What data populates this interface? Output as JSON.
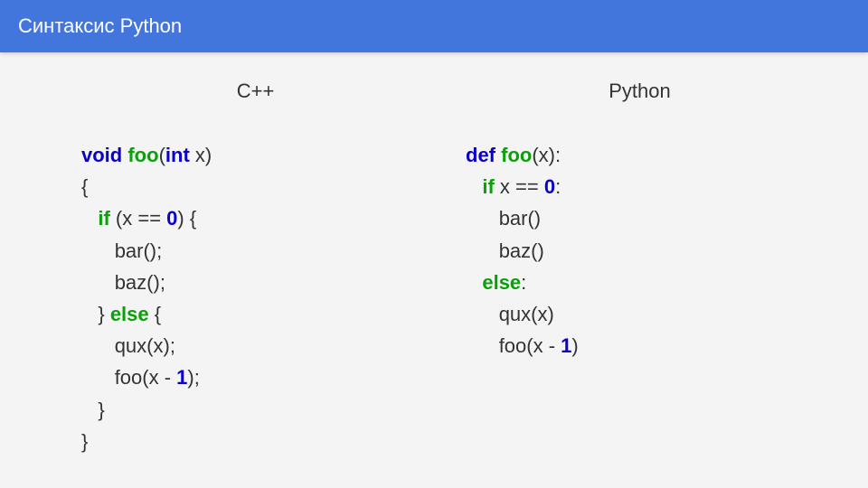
{
  "header": {
    "title": "Синтаксис Python"
  },
  "columns": {
    "left": {
      "title": "C++"
    },
    "right": {
      "title": "Python"
    }
  },
  "cpp": {
    "kw_void": "void",
    "fn_name": "foo",
    "kw_int": "int",
    "param": "x",
    "kw_if": "if",
    "cond_lhs": "x == ",
    "cond_zero": "0",
    "call_bar": "bar()",
    "call_baz": "baz()",
    "kw_else": "else",
    "call_qux": "qux(x)",
    "call_foo_pre": "foo(x - ",
    "one": "1",
    "call_foo_post": ")",
    "semi": ";"
  },
  "py": {
    "kw_def": "def",
    "fn_name": "foo",
    "param": "x",
    "kw_if": "if",
    "cond_lhs": "x == ",
    "cond_zero": "0",
    "call_bar": "bar()",
    "call_baz": "baz()",
    "kw_else": "else",
    "call_qux": "qux(x)",
    "call_foo_pre": "foo(x - ",
    "one": "1",
    "call_foo_post": ")"
  }
}
